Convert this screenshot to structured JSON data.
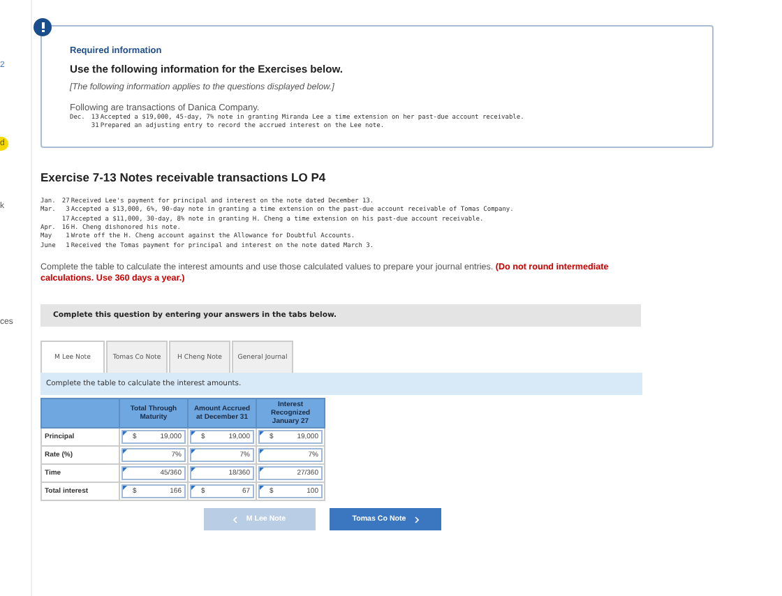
{
  "sidebar_fragments": [
    "2",
    "d",
    "k",
    "ces"
  ],
  "info": {
    "heading": "Required information",
    "title": "Use the following information for the Exercises below.",
    "note": "[The following information applies to the questions displayed below.]",
    "intro": "Following are transactions of Danica Company.",
    "transactions": [
      {
        "month": "Dec.",
        "day": "13",
        "text": "Accepted a $19,000, 45-day, 7% note in granting Miranda Lee a time extension on her past-due account receivable."
      },
      {
        "day": "31",
        "text": "Prepared an adjusting entry to record the accrued interest on the Lee note."
      }
    ]
  },
  "exercise": {
    "title": "Exercise 7-13 Notes receivable transactions LO P4",
    "transactions": [
      {
        "month": "Jan.",
        "day": "27",
        "text": "Received Lee's payment for principal and interest on the note dated December 13."
      },
      {
        "month": "Mar.",
        "day": "3",
        "text": "Accepted a $13,000, 6%, 90-day note in granting a time extension on the past-due account receivable of Tomas Company."
      },
      {
        "day": "17",
        "text": "Accepted a $11,000, 30-day, 8% note in granting H. Cheng a time extension on his past-due account receivable."
      },
      {
        "month": "Apr.",
        "day": "16",
        "text": "H. Cheng dishonored his note."
      },
      {
        "month": "May",
        "day": "1",
        "text": "Wrote off the H. Cheng account against the Allowance for Doubtful Accounts."
      },
      {
        "month": "June",
        "day": "1",
        "text": "Received the Tomas payment for principal and interest on the note dated March 3."
      }
    ],
    "instructions": "Complete the table to calculate the interest amounts and use those calculated values to prepare your journal entries. **(Do not round intermediate calculations. Use 360 days a year.)**"
  },
  "question_banner": "Complete this question by entering your answers in the tabs below.",
  "tabs": [
    {
      "label": "M Lee Note",
      "selected": true
    },
    {
      "label": "Tomas Co Note",
      "selected": false
    },
    {
      "label": "H Cheng Note",
      "selected": false
    },
    {
      "label": "General Journal",
      "selected": false
    }
  ],
  "table_hint": "Complete the table to calculate the interest amounts.",
  "table": {
    "columns": [
      "Total Through Maturity",
      "Amount Accrued at December 31",
      "Interest Recognized January 27"
    ],
    "rows": [
      {
        "label": "Principal",
        "cells": [
          {
            "prefix": "$",
            "value": "19,000"
          },
          {
            "prefix": "$",
            "value": "19,000"
          },
          {
            "prefix": "$",
            "value": "19,000"
          }
        ]
      },
      {
        "label": "Rate (%)",
        "cells": [
          {
            "value": "7%"
          },
          {
            "value": "7%"
          },
          {
            "value": "7%"
          }
        ]
      },
      {
        "label": "Time",
        "cells": [
          {
            "value": "45/360"
          },
          {
            "value": "18/360"
          },
          {
            "value": "27/360"
          }
        ]
      },
      {
        "label": "Total interest",
        "cells": [
          {
            "prefix": "$",
            "value": "166"
          },
          {
            "prefix": "$",
            "value": "67"
          },
          {
            "prefix": "$",
            "value": "100"
          }
        ]
      }
    ]
  },
  "nav": {
    "prev": {
      "label": "M Lee Note",
      "disabled": true
    },
    "next": {
      "label": "Tomas Co Note",
      "disabled": false
    }
  }
}
